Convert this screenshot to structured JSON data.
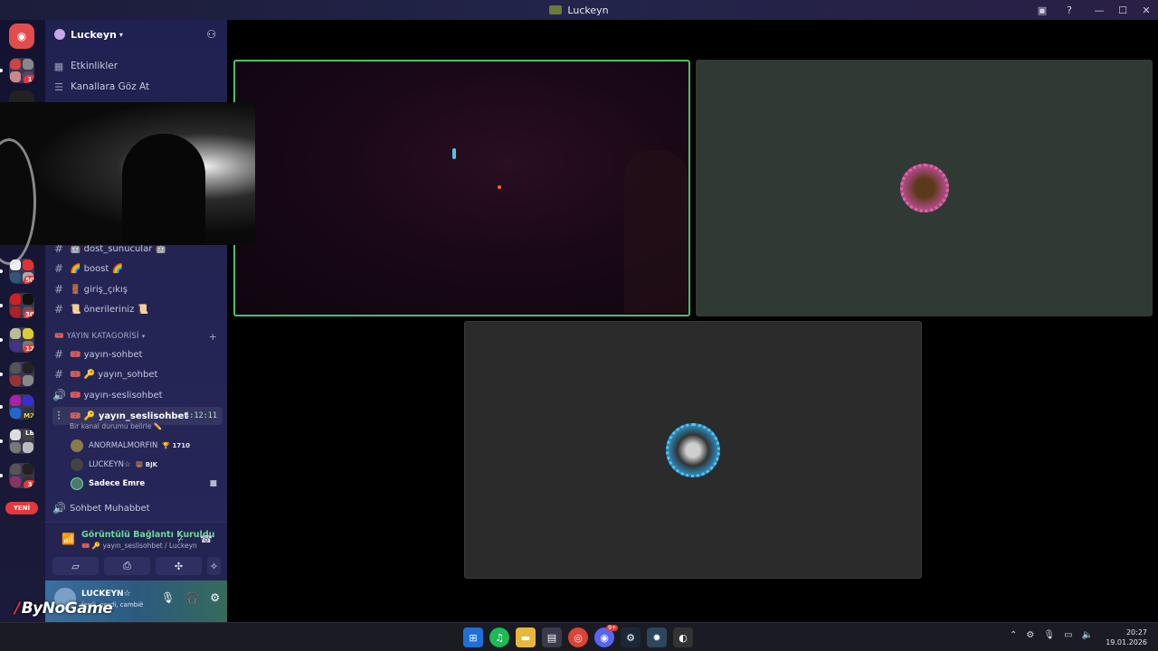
{
  "window": {
    "title": "Luckeyn"
  },
  "server": {
    "name": "Luckeyn"
  },
  "nav": [
    {
      "icon": "calendar-icon",
      "label": "Etkinlikler"
    },
    {
      "icon": "browse-channels-icon",
      "label": "Kanallara Göz At"
    }
  ],
  "channels_top": [
    {
      "label": "🤖 dost_sunucular 🤖"
    },
    {
      "label": "🌈 boost 🌈"
    },
    {
      "label": "🚪 giriş_çıkış"
    },
    {
      "label": "📜 önerileriniz 📜"
    }
  ],
  "category": {
    "label": "🎟️ YAYIN KATAGORİSİ"
  },
  "channels_stream": [
    {
      "type": "text",
      "label": "🎟️ yayın-sohbet"
    },
    {
      "type": "text",
      "label": "🎟️ 🔑 yayın_sohbet"
    },
    {
      "type": "voice",
      "label": "🎟️ yayın-seslisohbet"
    }
  ],
  "active_voice": {
    "label": "🎟️ 🔑 yayın_seslisohbet",
    "timer": "4:12:11",
    "status_hint": "Bir kanal durumu belirle ✏️",
    "users": [
      {
        "name": "ANORMALMORFIN",
        "tag": "🏆 1710"
      },
      {
        "name": "LUCKEYN☆",
        "tag": "🐻 BJK"
      },
      {
        "name": "Sadece Emre",
        "tag": ""
      }
    ]
  },
  "channel_after": {
    "label": "Sohbet Muhabbet"
  },
  "voice_panel": {
    "status": "Görüntülü Bağlantı Kuruldu",
    "location": "🎟️ 🔑 yayın_seslisohbet / Luckeyn"
  },
  "user": {
    "name": "LUCKEYN☆",
    "sub": "ferdi, gerdi, cambië"
  },
  "watermark": "ByNoGame",
  "rail": {
    "new_label": "YENİ",
    "badges": [
      "1",
      "50",
      "30",
      "12",
      "M2",
      "LB",
      "3"
    ]
  },
  "taskbar": {
    "time": "20:27",
    "date": "19.01.2026",
    "discord_badge": "9+"
  },
  "colors": {
    "speaking_border": "#4fbf6a",
    "connected_green": "#6fd89c",
    "badge_red": "#e5383b"
  }
}
